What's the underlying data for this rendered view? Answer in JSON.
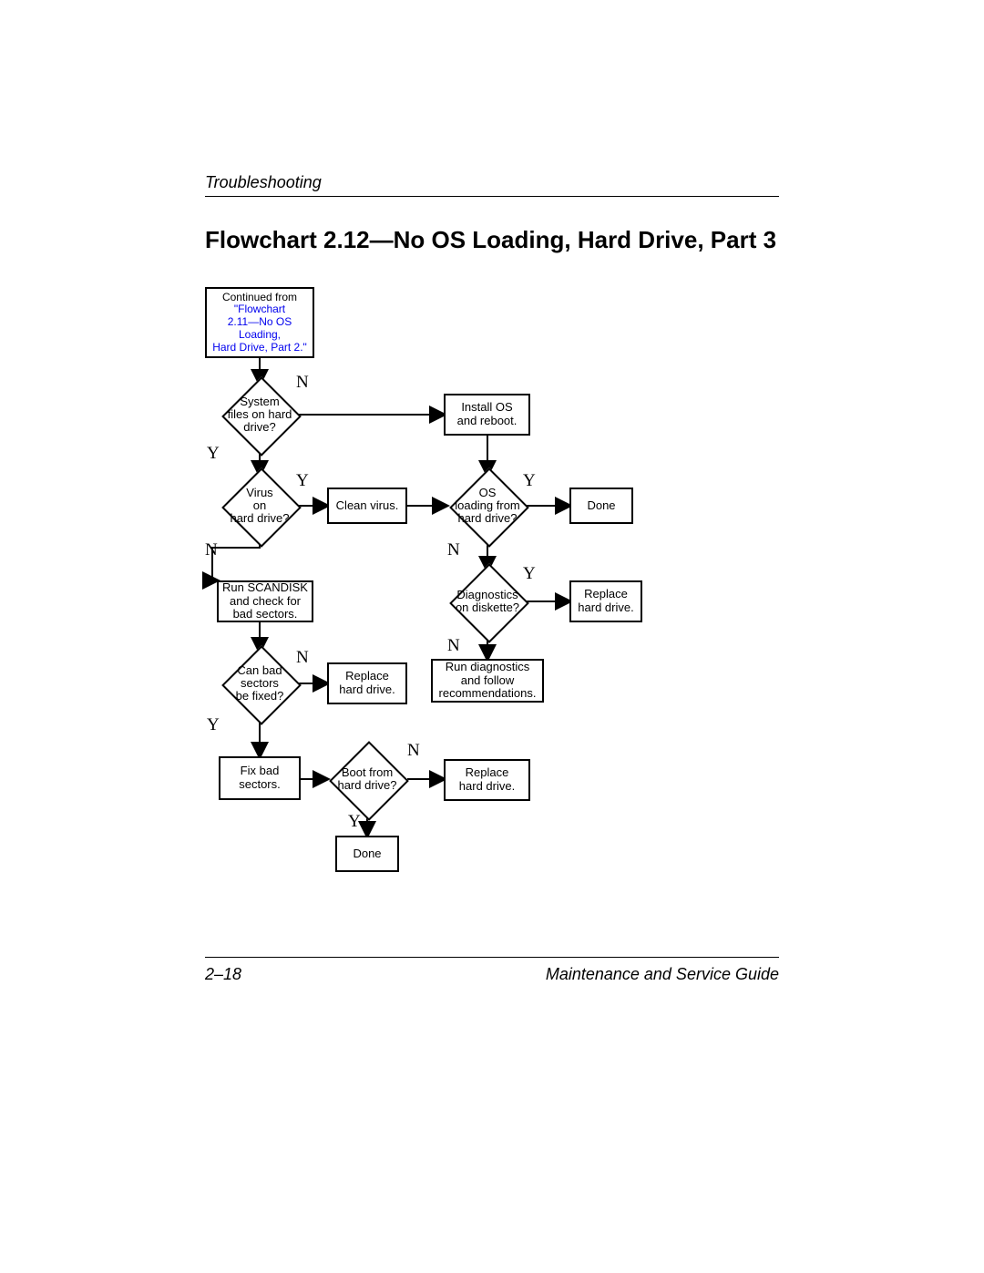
{
  "header": {
    "section": "Troubleshooting"
  },
  "title": "Flowchart 2.12—No OS Loading, Hard Drive, Part 3",
  "footer": {
    "page": "2–18",
    "guide": "Maintenance and Service Guide"
  },
  "nodes": {
    "continued_prefix": "Continued from",
    "continued_link1": "\"Flowchart",
    "continued_link2": "2.11—No OS",
    "continued_link3": "Loading,",
    "continued_link4": "Hard Drive, Part 2.\"",
    "system_files": "System\nfiles on hard\ndrive?",
    "install_os": "Install OS\nand reboot.",
    "virus": "Virus\non\nhard drive?",
    "clean_virus": "Clean virus.",
    "os_loading": "OS\nloading from\nhard drive?",
    "done": "Done",
    "scandisk": "Run SCANDISK\nand check for\nbad sectors.",
    "diag_diskette": "Diagnostics\non diskette?",
    "replace_hd1": "Replace\nhard drive.",
    "can_fix": "Can bad\nsectors\nbe fixed?",
    "replace_hd2": "Replace\nhard drive.",
    "run_diag": "Run diagnostics\nand follow\nrecommendations.",
    "fix_bad": "Fix bad\nsectors.",
    "boot_from": "Boot from\nhard drive?",
    "replace_hd3": "Replace\nhard drive.",
    "done2": "Done"
  },
  "labels": {
    "Y": "Y",
    "N": "N"
  },
  "chart_data": {
    "type": "flowchart",
    "title": "Flowchart 2.12—No OS Loading, Hard Drive, Part 3",
    "nodes": [
      {
        "id": "start",
        "shape": "process",
        "text": "Continued from \"Flowchart 2.11—No OS Loading, Hard Drive, Part 2.\""
      },
      {
        "id": "sysfiles",
        "shape": "decision",
        "text": "System files on hard drive?"
      },
      {
        "id": "installos",
        "shape": "process",
        "text": "Install OS and reboot."
      },
      {
        "id": "virus",
        "shape": "decision",
        "text": "Virus on hard drive?"
      },
      {
        "id": "clean",
        "shape": "process",
        "text": "Clean virus."
      },
      {
        "id": "osload",
        "shape": "decision",
        "text": "OS loading from hard drive?"
      },
      {
        "id": "done1",
        "shape": "process",
        "text": "Done"
      },
      {
        "id": "scandisk",
        "shape": "process",
        "text": "Run SCANDISK and check for bad sectors."
      },
      {
        "id": "diag",
        "shape": "decision",
        "text": "Diagnostics on diskette?"
      },
      {
        "id": "replace1",
        "shape": "process",
        "text": "Replace hard drive."
      },
      {
        "id": "canfix",
        "shape": "decision",
        "text": "Can bad sectors be fixed?"
      },
      {
        "id": "replace2",
        "shape": "process",
        "text": "Replace hard drive."
      },
      {
        "id": "rundiag",
        "shape": "process",
        "text": "Run diagnostics and follow recommendations."
      },
      {
        "id": "fixbad",
        "shape": "process",
        "text": "Fix bad sectors."
      },
      {
        "id": "boot",
        "shape": "decision",
        "text": "Boot from hard drive?"
      },
      {
        "id": "replace3",
        "shape": "process",
        "text": "Replace hard drive."
      },
      {
        "id": "done2",
        "shape": "process",
        "text": "Done"
      }
    ],
    "edges": [
      {
        "from": "start",
        "to": "sysfiles"
      },
      {
        "from": "sysfiles",
        "to": "installos",
        "label": "N"
      },
      {
        "from": "sysfiles",
        "to": "virus",
        "label": "Y"
      },
      {
        "from": "installos",
        "to": "osload"
      },
      {
        "from": "virus",
        "to": "clean",
        "label": "Y"
      },
      {
        "from": "virus",
        "to": "scandisk",
        "label": "N"
      },
      {
        "from": "clean",
        "to": "osload"
      },
      {
        "from": "osload",
        "to": "done1",
        "label": "Y"
      },
      {
        "from": "osload",
        "to": "diag",
        "label": "N"
      },
      {
        "from": "diag",
        "to": "replace1",
        "label": "Y"
      },
      {
        "from": "diag",
        "to": "rundiag",
        "label": "N"
      },
      {
        "from": "scandisk",
        "to": "canfix"
      },
      {
        "from": "canfix",
        "to": "replace2",
        "label": "N"
      },
      {
        "from": "canfix",
        "to": "fixbad",
        "label": "Y"
      },
      {
        "from": "fixbad",
        "to": "boot"
      },
      {
        "from": "boot",
        "to": "replace3",
        "label": "N"
      },
      {
        "from": "boot",
        "to": "done2",
        "label": "Y"
      }
    ]
  }
}
